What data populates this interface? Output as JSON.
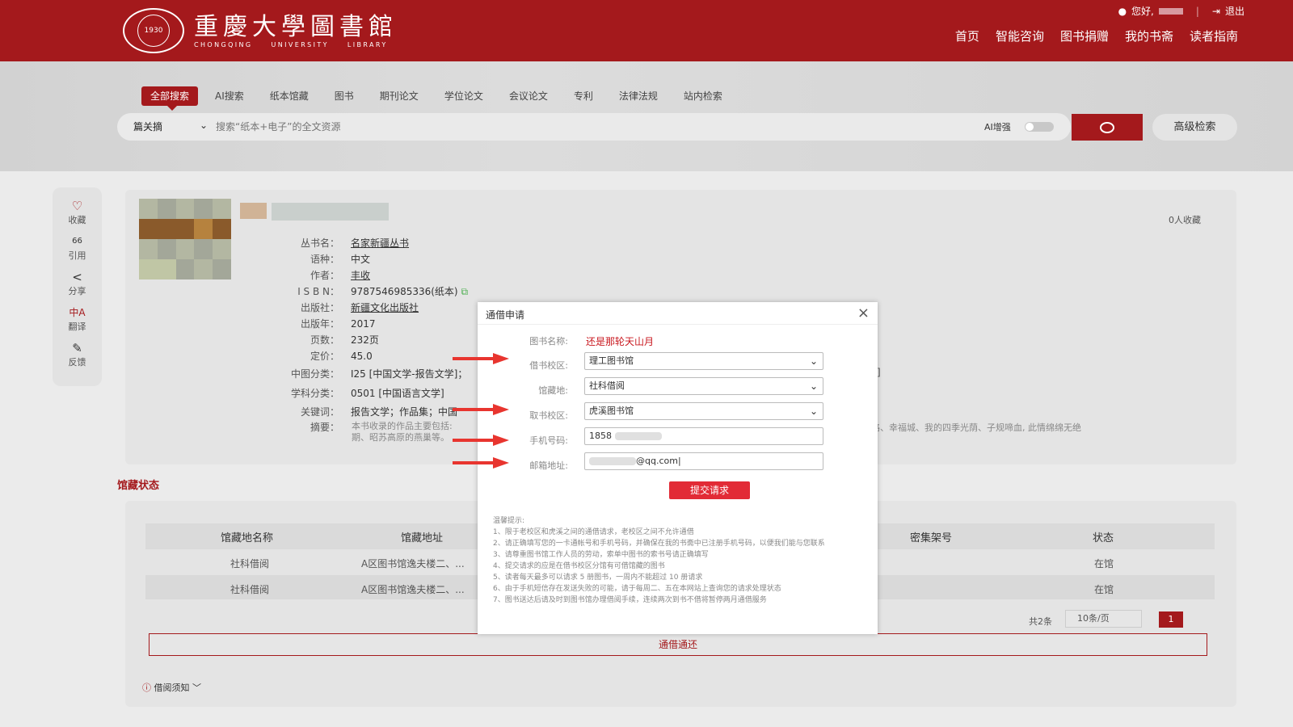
{
  "header": {
    "logo_cn": "重慶大學圖書館",
    "logo_en": "CHONGQING UNIVERSITY LIBRARY",
    "seal_year": "1930",
    "greeting": "您好,",
    "logout": "退出",
    "nav": [
      "首页",
      "智能咨询",
      "图书捐赠",
      "我的书斋",
      "读者指南"
    ]
  },
  "search": {
    "tabs": [
      "全部搜索",
      "AI搜索",
      "纸本馆藏",
      "图书",
      "期刊论文",
      "学位论文",
      "会议论文",
      "专利",
      "法律法规",
      "站内检索"
    ],
    "active_tab": "全部搜索",
    "scope": "篇关摘",
    "placeholder": "搜索“纸本+电子”的全文资源",
    "ai_label": "AI增强",
    "advanced": "高级检索"
  },
  "tools": [
    {
      "icon": "heart-icon",
      "glyph": "♡",
      "label": "收藏"
    },
    {
      "icon": "quote-icon",
      "glyph": "66",
      "label": "引用"
    },
    {
      "icon": "share-icon",
      "glyph": "<",
      "label": "分享"
    },
    {
      "icon": "translate-icon",
      "glyph": "中A",
      "label": "翻译"
    },
    {
      "icon": "feedback-icon",
      "glyph": "✎",
      "label": "反馈"
    }
  ],
  "book": {
    "fav_count": "0人收藏",
    "fields": [
      {
        "k": "丛书名：",
        "v": "名家新疆丛书"
      },
      {
        "k": "语种：",
        "v": "中文"
      },
      {
        "k": "作者：",
        "v": "丰收"
      },
      {
        "k": "I S B N：",
        "v": "9787546985336(纸本)"
      },
      {
        "k": "出版社：",
        "v": "新疆文化出版社"
      },
      {
        "k": "出版年：",
        "v": "2017"
      },
      {
        "k": "页数：",
        "v": "232页"
      },
      {
        "k": "定价：",
        "v": "45.0"
      },
      {
        "k": "中图分类：",
        "v": "I25 [中国文学-报告文学]；"
      },
      {
        "k": "学科分类：",
        "v": "0501 [中国语言文学]"
      },
      {
        "k": "关键词：",
        "v": "报告文学；作品集；中国"
      },
      {
        "k": "摘要：",
        "v": ""
      }
    ],
    "abstract_line1": "本书收录的作品主要包括:",
    "abstract_line2": "期、昭苏高原的燕巢等。",
    "abstract_right": "路、幸福城、我的四季光荫、子规啼血, 此情绵绵无绝",
    "bracket": "]"
  },
  "holdings": {
    "title": "馆藏状态",
    "headers": [
      "馆藏地名称",
      "馆藏地址",
      "密集架号",
      "状态"
    ],
    "rows": [
      [
        "社科借阅",
        "A区图书馆逸夫楼二、...",
        "",
        "在馆"
      ],
      [
        "社科借阅",
        "A区图书馆逸夫楼二、...",
        "",
        "在馆"
      ]
    ],
    "total": "共2条",
    "page_size": "10条/页",
    "page": "1",
    "borrow_button": "通借通还",
    "notice": "借阅须知"
  },
  "modal": {
    "title": "通借申请",
    "book_name_label": "图书名称:",
    "book_name": "还是那轮天山月",
    "borrow_campus_label": "借书校区:",
    "borrow_campus": "理工图书馆",
    "location_label": "馆藏地:",
    "location": "社科借阅",
    "pickup_campus_label": "取书校区:",
    "pickup_campus": "虎溪图书馆",
    "phone_label": "手机号码:",
    "phone": "1858",
    "email_label": "邮箱地址:",
    "email": "@qq.com",
    "submit": "提交请求",
    "tips_title": "温馨提示:",
    "tips": [
      "1、限于老校区和虎溪之间的通借请求，老校区之间不允许通借",
      "2、请正确填写您的一卡通帐号和手机号码，并确保在我的书斋中已注册手机号码，以便我们能与您联系",
      "3、请尊重图书馆工作人员的劳动，索单中图书的索书号请正确填写",
      "4、提交请求的应是在借书校区分馆有可借馆藏的图书",
      "5、读者每天最多可以请求 5 册图书，一周内不能超过 10 册请求",
      "6、由于手机短信存在发送失败的可能，请于每周二、五在本网站上查询您的请求处理状态",
      "7、图书送达后请及时到图书馆办理借阅手续，连续两次到书不借将暂停两月通借服务"
    ]
  },
  "colors": {
    "brand": "#a4191c",
    "submit": "#e22b36",
    "arrow": "#e8352f"
  }
}
